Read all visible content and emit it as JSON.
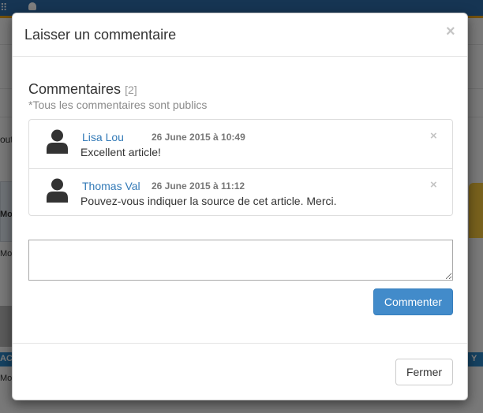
{
  "background": {
    "fragments": [
      "out",
      "Mo",
      "Moc",
      "AC",
      "Moc",
      "Y"
    ]
  },
  "modal": {
    "title": "Laisser un commentaire",
    "close_label": "×",
    "section_title": "Commentaires",
    "comment_count": "[2]",
    "notice": "*Tous les commentaires sont publics",
    "comments": [
      {
        "author": "Lisa Lou",
        "date": "26 June 2015 à 10:49",
        "text": "Excellent article!",
        "delete_label": "×"
      },
      {
        "author": "Thomas Val",
        "date": "26 June 2015 à 11:12",
        "text": "Pouvez-vous indiquer la source de cet article. Merci.",
        "delete_label": "×"
      }
    ],
    "textarea_value": "",
    "submit_label": "Commenter",
    "close_button_label": "Fermer"
  },
  "colors": {
    "primary": "#428bca",
    "link": "#337ab7",
    "topbar": "#2c6aa6",
    "topbar_accent": "#e7a21a"
  },
  "icons": {
    "avatar": "user-silhouette-icon",
    "close": "close-icon",
    "delete": "delete-icon",
    "menu": "grid-icon",
    "bell": "bell-icon"
  }
}
